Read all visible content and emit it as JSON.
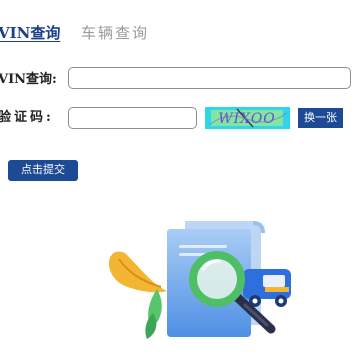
{
  "tabs": {
    "vin_label": "VIN查询",
    "vehicle_label": "车辆查询"
  },
  "form": {
    "vin_label": "VIN查询:",
    "vin_value": "",
    "captcha_label": "验证码:",
    "captcha_value": "",
    "captcha_text": "WIXOO",
    "refresh_label": "换一张",
    "submit_label": "点击提交"
  },
  "colors": {
    "primary": "#1d4a94",
    "tab_active": "#1a3f8b",
    "tab_inactive": "#9a9a9a",
    "captcha_bg": "#2fd6e8"
  },
  "illustration": {
    "icons": [
      "document-icon",
      "magnifier-icon",
      "truck-icon",
      "leaf-icon"
    ]
  }
}
